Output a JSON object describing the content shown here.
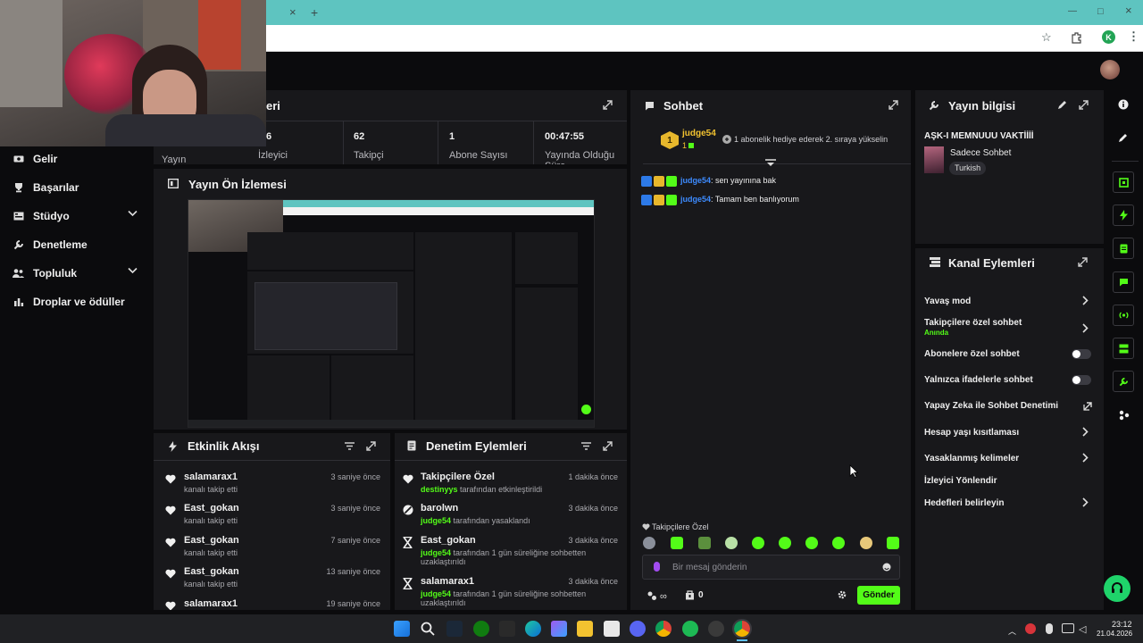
{
  "browser": {
    "tab_close": "×",
    "tab_new": "+",
    "profile_initial": "K",
    "window_min": "—",
    "window_max": "□",
    "window_close": "×"
  },
  "stats": {
    "viewers_title_fragment": "eri",
    "cells": [
      {
        "value": "",
        "label": "Yayın"
      },
      {
        "value": "6",
        "label": "İzleyici"
      },
      {
        "value": "62",
        "label": "Takipçi"
      },
      {
        "value": "1",
        "label": "Abone Sayısı"
      },
      {
        "value": "00:47:55",
        "label": "Yayında Olduğu Süre"
      }
    ]
  },
  "sidebar": {
    "items": [
      {
        "label": "Gelir",
        "icon": "dollar-icon"
      },
      {
        "label": "Başarılar",
        "icon": "trophy-icon"
      },
      {
        "label": "Stüdyo",
        "icon": "studio-icon",
        "expandable": true
      },
      {
        "label": "Denetleme",
        "icon": "wrench-icon"
      },
      {
        "label": "Topluluk",
        "icon": "people-icon",
        "expandable": true
      },
      {
        "label": "Droplar ve ödüller",
        "icon": "drops-icon"
      }
    ]
  },
  "preview": {
    "title": "Yayın Ön İzlemesi"
  },
  "activity": {
    "title": "Etkinlik Akışı",
    "items": [
      {
        "name": "salamarax1",
        "detail": "kanalı takip etti",
        "time": "3 saniye önce"
      },
      {
        "name": "East_gokan",
        "detail": "kanalı takip etti",
        "time": "3 saniye önce"
      },
      {
        "name": "East_gokan",
        "detail": "kanalı takip etti",
        "time": "7 saniye önce"
      },
      {
        "name": "East_gokan",
        "detail": "kanalı takip etti",
        "time": "13 saniye önce"
      },
      {
        "name": "salamarax1",
        "detail": "",
        "time": "19 saniye önce"
      }
    ]
  },
  "moderation": {
    "title": "Denetim Eylemleri",
    "items": [
      {
        "name": "Takipçilere Özel",
        "actor": "destinyys",
        "detail": "tarafından etkinleştirildi",
        "detail2": "",
        "time": "1 dakika önce"
      },
      {
        "name": "barolwn",
        "actor": "judge54",
        "detail": "tarafından yasaklandı",
        "detail2": "",
        "time": "3 dakika önce"
      },
      {
        "name": "East_gokan",
        "actor": "judge54",
        "detail": "tarafından 1 gün süreliğine sohbetten",
        "detail2": "uzaklaştırıldı",
        "time": "3 dakika önce"
      },
      {
        "name": "salamarax1",
        "actor": "judge54",
        "detail": "tarafından 1 gün süreliğine sohbetten",
        "detail2": "uzaklaştırıldı",
        "time": "3 dakika önce"
      }
    ]
  },
  "chat": {
    "title": "Sohbet",
    "pinned_user": "judge54",
    "pinned_count": "1",
    "pinned_rank": "1",
    "pinned_message": "1 abonelik hediye ederek 2. sıraya yükselin",
    "messages": [
      {
        "user": "judge54",
        "text": ": sen yayınına bak"
      },
      {
        "user": "judge54",
        "text": ": Tamam ben banlıyorum"
      }
    ],
    "mode_label": "Takipçilere Özel",
    "input_placeholder": "Bir mesaj gönderin",
    "points": "0",
    "send_label": "Gönder"
  },
  "stream_info": {
    "title": "Yayın bilgisi",
    "stream_title": "AŞK-I MEMNUUU VAKTİİİİ",
    "category": "Sadece Sohbet",
    "language": "Turkish"
  },
  "channel_actions": {
    "title": "Kanal Eylemleri",
    "items": [
      {
        "label": "Yavaş mod",
        "control": "chevron"
      },
      {
        "label": "Takipçilere özel sohbet",
        "sub": "Anında",
        "control": "chevron"
      },
      {
        "label": "Abonelere özel sohbet",
        "control": "toggle"
      },
      {
        "label": "Yalnızca ifadelerle sohbet",
        "control": "toggle"
      },
      {
        "label": "Yapay Zeka ile Sohbet Denetimi",
        "control": "external"
      },
      {
        "label": "Hesap yaşı kısıtlaması",
        "control": "chevron"
      },
      {
        "label": "Yasaklanmış kelimeler",
        "control": "chevron"
      },
      {
        "label": "İzleyici Yönlendir",
        "control": "none"
      },
      {
        "label": "Hedefleri belirleyin",
        "control": "chevron"
      }
    ]
  },
  "taskbar": {
    "time": "23:12",
    "date": "21.04.2026"
  },
  "colors": {
    "accent": "#53fc18",
    "panel": "#18181b",
    "background": "#0b0b0d",
    "tabstrip": "#5ec4c0"
  }
}
